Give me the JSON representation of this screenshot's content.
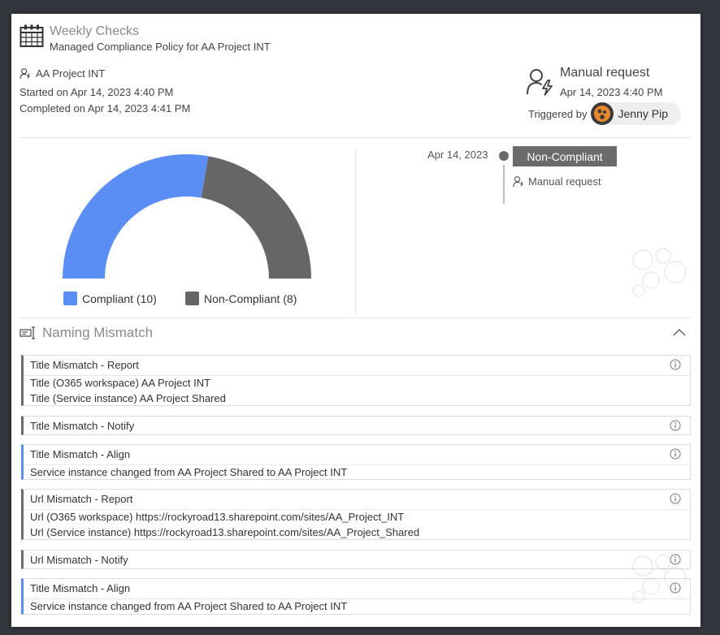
{
  "header": {
    "title": "Weekly Checks",
    "subtitle": "Managed Compliance Policy for AA Project INT"
  },
  "meta": {
    "project": "AA Project INT",
    "started": "Started on Apr 14, 2023 4:40 PM",
    "completed": "Completed on Apr 14, 2023 4:41 PM"
  },
  "request": {
    "title": "Manual request",
    "date": "Apr 14, 2023 4:40 PM",
    "triggered_label": "Triggered by",
    "user": "Jenny Pip"
  },
  "chart_data": {
    "type": "pie",
    "style": "half-donut",
    "categories": [
      "Compliant",
      "Non-Compliant"
    ],
    "values": [
      10,
      8
    ],
    "colors": [
      "#5b8ef5",
      "#666666"
    ],
    "legend": [
      "Compliant (10)",
      "Non-Compliant (8)"
    ],
    "legend_position": "bottom"
  },
  "timeline": {
    "date": "Apr 14, 2023",
    "status": "Non-Compliant",
    "request": "Manual request"
  },
  "section": {
    "title": "Naming Mismatch"
  },
  "cards": [
    {
      "title": "Title Mismatch - Report",
      "accent": "gray",
      "lines": [
        "Title (O365 workspace) AA Project INT",
        "Title (Service instance) AA Project Shared"
      ]
    },
    {
      "title": "Title Mismatch - Notify",
      "accent": "gray",
      "lines": []
    },
    {
      "title": "Title Mismatch - Align",
      "accent": "blue",
      "lines": [
        "Service instance changed from AA Project Shared to AA Project INT"
      ]
    },
    {
      "title": "Url Mismatch - Report",
      "accent": "gray",
      "lines": [
        "Url (O365 workspace) https://rockyroad13.sharepoint.com/sites/AA_Project_INT",
        "Url (Service instance) https://rockyroad13.sharepoint.com/sites/AA_Project_Shared"
      ]
    },
    {
      "title": "Url Mismatch - Notify",
      "accent": "gray",
      "lines": []
    },
    {
      "title": "Title Mismatch - Align",
      "accent": "blue",
      "lines": [
        "Service instance changed from AA Project Shared to AA Project INT"
      ]
    }
  ],
  "colors": {
    "compliant": "#5b8ef5",
    "non_compliant": "#666666",
    "accent_gray": "#6b6b6b"
  },
  "icons": {
    "calendar": "calendar-icon",
    "user_lightning": "user-lightning-icon",
    "naming": "naming-icon",
    "info": "info-icon",
    "chevron_up": "chevron-up-icon"
  }
}
